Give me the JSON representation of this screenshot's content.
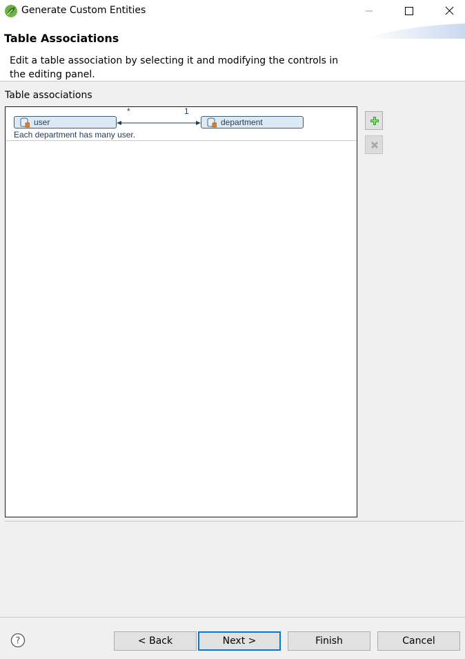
{
  "window": {
    "title": "Generate Custom Entities",
    "app_icon": "spring-leaf-icon",
    "controls": [
      "minimize-icon",
      "maximize-icon",
      "close-icon"
    ]
  },
  "header": {
    "title": "Table Associations",
    "description": "Edit a table association by selecting it and modifying the controls in the editing panel."
  },
  "associations": {
    "label": "Table associations",
    "items": [
      {
        "from_table": "user",
        "to_table": "department",
        "from_cardinality": "*",
        "to_cardinality": "1",
        "description": "Each department has many user."
      }
    ]
  },
  "side_buttons": {
    "add_icon": "plus-icon",
    "remove_icon": "remove-x-icon"
  },
  "footer": {
    "help_icon": "help-icon",
    "back_label": "< Back",
    "next_label": "Next >",
    "finish_label": "Finish",
    "cancel_label": "Cancel"
  },
  "colors": {
    "accent": "#0078d7",
    "table_box": "#dde9f3",
    "association_text": "#1f3b5a",
    "add_icon": "#3c9a2e"
  }
}
